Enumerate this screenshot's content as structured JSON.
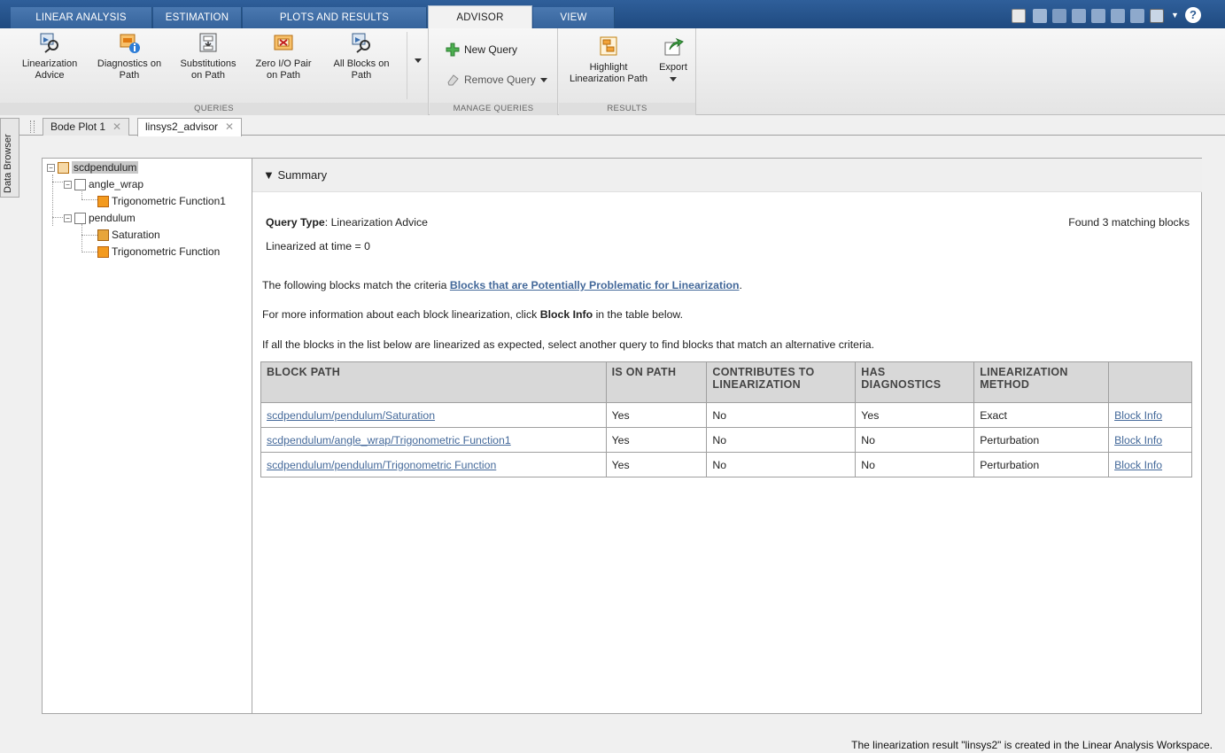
{
  "tabs": [
    {
      "label": "LINEAR ANALYSIS",
      "active": false
    },
    {
      "label": "ESTIMATION",
      "active": false
    },
    {
      "label": "PLOTS AND RESULTS",
      "active": false
    },
    {
      "label": "ADVISOR",
      "active": true
    },
    {
      "label": "VIEW",
      "active": false
    }
  ],
  "ribbon": {
    "queries": {
      "label": "QUERIES",
      "buttons": [
        {
          "line1": "Linearization",
          "line2": "Advice"
        },
        {
          "line1": "Diagnostics on",
          "line2": "Path"
        },
        {
          "line1": "Substitutions",
          "line2": "on Path"
        },
        {
          "line1": "Zero I/O Pair",
          "line2": "on Path"
        },
        {
          "line1": "All Blocks on",
          "line2": "Path"
        }
      ]
    },
    "manage": {
      "label": "MANAGE QUERIES",
      "new_query": "New Query",
      "remove_query": "Remove Query"
    },
    "results": {
      "label": "RESULTS",
      "highlight_line1": "Highlight",
      "highlight_line2": "Linearization Path",
      "export": "Export"
    }
  },
  "doc_tabs": [
    {
      "label": "Bode Plot 1"
    },
    {
      "label": "linsys2_advisor"
    }
  ],
  "sidebar_label": "Data Browser",
  "tree": {
    "root": "scdpendulum",
    "angle_wrap": "angle_wrap",
    "trig1": "Trigonometric Function1",
    "pendulum": "pendulum",
    "saturation": "Saturation",
    "trig": "Trigonometric Function"
  },
  "summary": {
    "header": "Summary",
    "query_type_label": "Query Type",
    "query_type_value": ": Linearization Advice",
    "found": "Found 3 matching blocks",
    "linearized_at": "Linearized at time = 0",
    "criteria_prefix": "The following blocks match the criteria ",
    "criteria_link": "Blocks that are Potentially Problematic for Linearization",
    "criteria_suffix": ".",
    "info_prefix": "For more information about each block linearization, click ",
    "info_bold": "Block Info",
    "info_suffix": " in the table below.",
    "alt_text": "If all the blocks in the list below are linearized as expected, select another query to find blocks that match an alternative criteria."
  },
  "table": {
    "headers": [
      "BLOCK PATH",
      "IS ON PATH",
      "CONTRIBUTES TO LINEARIZATION",
      "HAS DIAGNOSTICS",
      "LINEARIZATION METHOD",
      ""
    ],
    "rows": [
      [
        "scdpendulum/pendulum/Saturation",
        "Yes",
        "No",
        "Yes",
        "Exact",
        "Block Info"
      ],
      [
        "scdpendulum/angle_wrap/Trigonometric Function1",
        "Yes",
        "No",
        "No",
        "Perturbation",
        "Block Info"
      ],
      [
        "scdpendulum/pendulum/Trigonometric Function",
        "Yes",
        "No",
        "No",
        "Perturbation",
        "Block Info"
      ]
    ]
  },
  "status": "The linearization result \"linsys2\" is created in the Linear Analysis Workspace."
}
